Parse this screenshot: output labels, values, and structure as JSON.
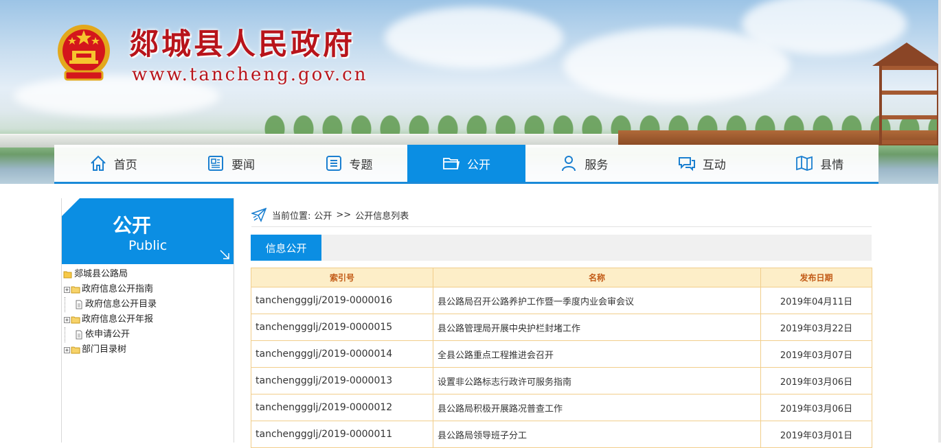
{
  "site": {
    "title": "郯城县人民政府",
    "url": "www.tancheng.gov.cn"
  },
  "nav": {
    "items": [
      {
        "label": "首页",
        "icon": "home-icon"
      },
      {
        "label": "要闻",
        "icon": "newspaper-icon"
      },
      {
        "label": "专题",
        "icon": "list-icon"
      },
      {
        "label": "公开",
        "icon": "folder-icon",
        "active": true
      },
      {
        "label": "服务",
        "icon": "user-icon"
      },
      {
        "label": "互动",
        "icon": "chat-icon"
      },
      {
        "label": "县情",
        "icon": "map-icon"
      }
    ]
  },
  "sidebar": {
    "title": "公开",
    "subtitle": "Public",
    "tree": [
      {
        "label": "郯城县公路局",
        "type": "root-folder"
      },
      {
        "label": "政府信息公开指南",
        "type": "folder"
      },
      {
        "label": "政府信息公开目录",
        "type": "document"
      },
      {
        "label": "政府信息公开年报",
        "type": "folder"
      },
      {
        "label": "依申请公开",
        "type": "document"
      },
      {
        "label": "部门目录树",
        "type": "folder"
      }
    ]
  },
  "breadcrumb": {
    "prefix": "当前位置:",
    "level1": "公开",
    "separator": ">>",
    "level2": "公开信息列表"
  },
  "tab": {
    "label": "信息公开"
  },
  "table": {
    "headers": {
      "index": "索引号",
      "name": "名称",
      "date": "发布日期"
    },
    "rows": [
      {
        "index": "tanchenggglj/2019-0000016",
        "name": "县公路局召开公路养护工作暨一季度内业会审会议",
        "date": "2019年04月11日"
      },
      {
        "index": "tanchenggglj/2019-0000015",
        "name": "县公路管理局开展中央护栏封堵工作",
        "date": "2019年03月22日"
      },
      {
        "index": "tanchenggglj/2019-0000014",
        "name": "全县公路重点工程推进会召开",
        "date": "2019年03月07日"
      },
      {
        "index": "tanchenggglj/2019-0000013",
        "name": "设置非公路标志行政许可服务指南",
        "date": "2019年03月06日"
      },
      {
        "index": "tanchenggglj/2019-0000012",
        "name": "县公路局积极开展路况普查工作",
        "date": "2019年03月06日"
      },
      {
        "index": "tanchenggglj/2019-0000011",
        "name": "县公路局领导班子分工",
        "date": "2019年03月01日"
      }
    ]
  },
  "colors": {
    "primary": "#0b8ee3",
    "site_title": "#b8141b",
    "table_header_bg": "#fdeec8",
    "table_header_text": "#c25a16",
    "table_border": "#f1cd8a"
  }
}
